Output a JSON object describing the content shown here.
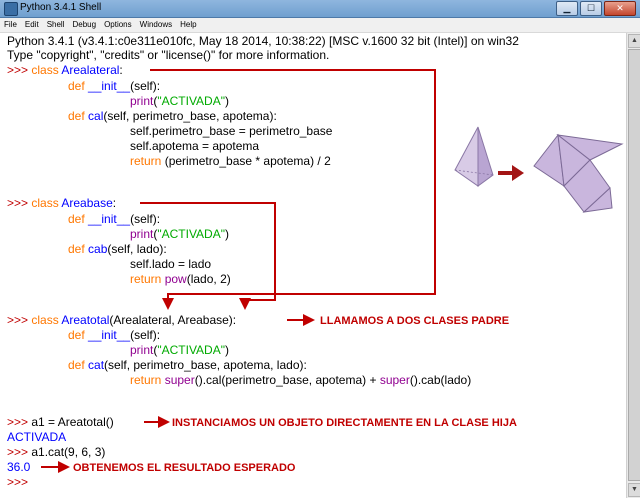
{
  "window": {
    "title": "Python 3.4.1 Shell"
  },
  "menu": [
    "File",
    "Edit",
    "Shell",
    "Debug",
    "Options",
    "Windows",
    "Help"
  ],
  "shell": {
    "banner1": "Python 3.4.1 (v3.4.1:c0e311e010fc, May 18 2014, 10:38:22) [MSC v.1600 32 bit (Intel)] on win32",
    "banner2": "Type \"copyright\", \"credits\" or \"license()\" for more information.",
    "prompt": ">>> ",
    "kw_class": "class",
    "kw_def": "def",
    "kw_return": "return",
    "init": "__init__",
    "self_paren": "(self):",
    "print": "print",
    "activada_str": "\"ACTIVADA\"",
    "paren_open": "(",
    "paren_close": ")",
    "c1_name": "Arealateral",
    "colon": ":",
    "c1_cal": "cal",
    "c1_cal_args": "(self, perimetro_base, apotema):",
    "c1_l1": "self.perimetro_base = perimetro_base",
    "c1_l2": "self.apotema = apotema",
    "c1_ret": " (perimetro_base * apotema) / 2",
    "c2_name": "Areabase",
    "c2_cab": "cab",
    "c2_cab_args": "(self, lado):",
    "c2_l1": "self.lado = lado",
    "c2_pow": "pow",
    "c2_pow_args": "(lado, 2)",
    "c3_name": "Areatotal",
    "c3_bases": "(Arealateral, Areabase):",
    "c3_cat": "cat",
    "c3_cat_args": "(self, perimetro_base, apotema, lado):",
    "super": "super",
    "c3_ret_a": "().cal(perimetro_base, apotema) + ",
    "c3_ret_b": "().cab(lado)",
    "inst_cmd": "a1 = Areatotal()",
    "out_activada": "ACTIVADA",
    "call_cmd": "a1.cat(9, 6, 3)",
    "result": "36.0",
    "last_prompt": ">>>"
  },
  "annotations": {
    "padre": "LLAMAMOS A DOS CLASES PADRE",
    "hija": "INSTANCIAMOS UN OBJETO DIRECTAMENTE EN LA CLASE HIJA",
    "resultado": "OBTENEMOS EL RESULTADO ESPERADO"
  },
  "colors": {
    "prompt": "#c00000",
    "keyword": "#ff7700",
    "defname": "#0000ff",
    "string": "#00aa00",
    "builtin": "#900090",
    "annotation": "#c00000",
    "pyramid": "#c9b6dd"
  }
}
